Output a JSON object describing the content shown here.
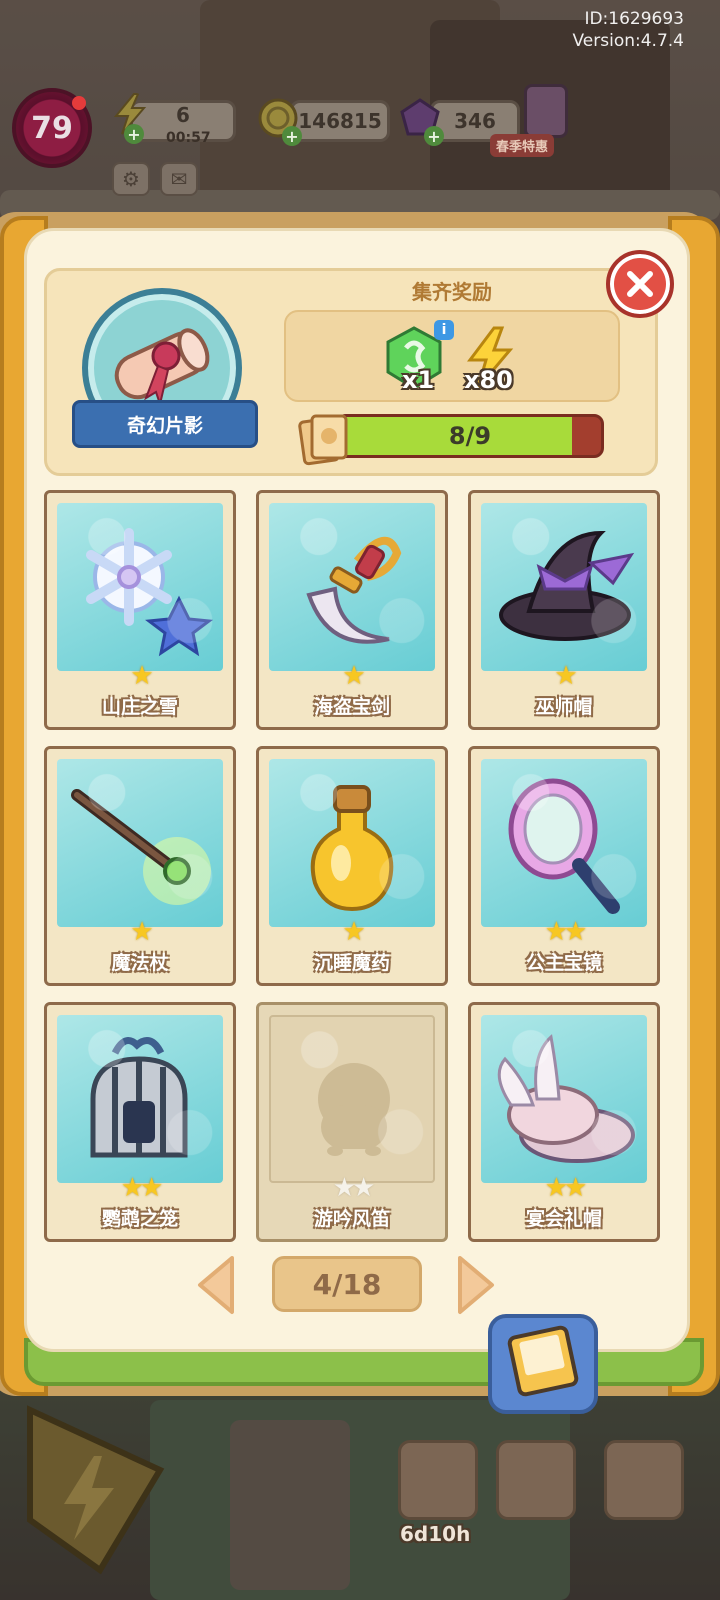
{
  "meta": {
    "id_line": "ID:1629693",
    "version_line": "Version:4.7.4"
  },
  "hud": {
    "level": "79",
    "energy": "6",
    "energy_timer": "00:57",
    "coins": "146815",
    "gems": "346",
    "event_badge": "春季特惠"
  },
  "album": {
    "set_name": "奇幻片影",
    "reward_title": "集齐奖励",
    "rewards": [
      {
        "icon": "green-gem-icon",
        "label": "x1"
      },
      {
        "icon": "energy-bolt-icon",
        "label": "x80"
      }
    ],
    "progress_text": "8/9",
    "progress": 0.8889
  },
  "cards": [
    {
      "name": "山庄之雪",
      "stars": "★",
      "icon": "snowflake-flower-icon",
      "collected": true
    },
    {
      "name": "海盗宝剑",
      "stars": "★",
      "icon": "pirate-sword-icon",
      "collected": true
    },
    {
      "name": "巫师帽",
      "stars": "★",
      "icon": "wizard-hat-icon",
      "collected": true
    },
    {
      "name": "魔法杖",
      "stars": "★",
      "icon": "magic-wand-icon",
      "collected": true
    },
    {
      "name": "沉睡魔药",
      "stars": "★",
      "icon": "potion-bottle-icon",
      "collected": true
    },
    {
      "name": "公主宝镜",
      "stars": "★★",
      "icon": "hand-mirror-icon",
      "collected": true
    },
    {
      "name": "鹦鹉之笼",
      "stars": "★★",
      "icon": "bird-cage-icon",
      "collected": true
    },
    {
      "name": "游吟风笛",
      "stars": "★★",
      "icon": "locked-silhouette-icon",
      "collected": false
    },
    {
      "name": "宴会礼帽",
      "stars": "★★",
      "icon": "feather-hat-icon",
      "collected": true
    }
  ],
  "pager": {
    "text": "4/18"
  },
  "bottom": {
    "event_timer": "6d10h"
  },
  "colors": {
    "accent_gold": "#e8a732",
    "progress_green": "#a8db3a",
    "card_sky": "#67cdd4",
    "close_red": "#e25045"
  }
}
